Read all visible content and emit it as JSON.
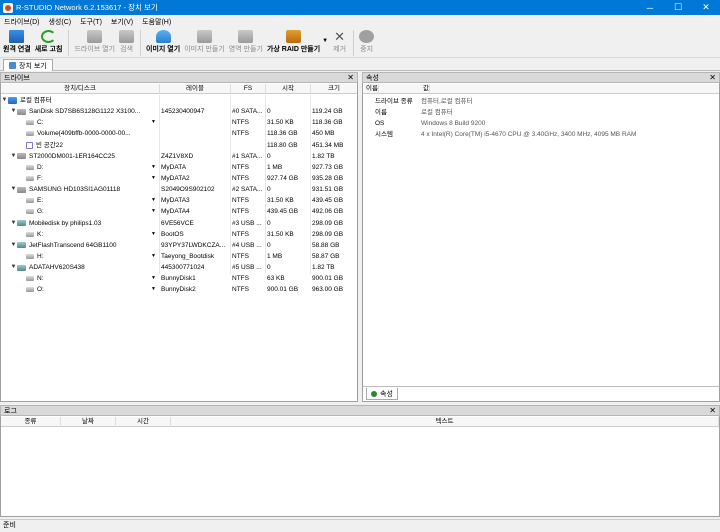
{
  "window": {
    "title": "R-STUDIO Network 6.2.153617 - 장치 보기",
    "minimize": "─",
    "maximize": "☐",
    "close": "✕"
  },
  "menu": [
    "드라이브(D)",
    "생성(C)",
    "도구(T)",
    "보기(V)",
    "도움말(H)"
  ],
  "toolbar": {
    "items": [
      {
        "label": "원격 연결",
        "icon": "remote-pc-icon",
        "enabled": true
      },
      {
        "label": "새로 고침",
        "icon": "refresh-icon",
        "enabled": true
      },
      {
        "label": "드라이브 열기",
        "icon": "open-drive-icon",
        "enabled": false
      },
      {
        "label": "검색",
        "icon": "search-icon",
        "enabled": false
      },
      {
        "label": "이미지 열기",
        "icon": "open-image-icon",
        "enabled": true
      },
      {
        "label": "이미지 만들기",
        "icon": "create-image-icon",
        "enabled": false
      },
      {
        "label": "영역 만들기",
        "icon": "create-region-icon",
        "enabled": false
      },
      {
        "label": "가상 RAID 만들기",
        "icon": "virtual-raid-icon",
        "enabled": true
      },
      {
        "label": "제거",
        "icon": "remove-icon",
        "enabled": false
      },
      {
        "label": "중지",
        "icon": "stop-icon",
        "enabled": false
      }
    ]
  },
  "tabs": {
    "device_view": "장치 보기"
  },
  "drives_panel": {
    "title": "드라이브",
    "columns": {
      "device": "장치/디스크",
      "label": "레이블",
      "fs": "FS",
      "start": "시작",
      "size": "크기"
    },
    "rows": [
      {
        "indent": 0,
        "caret": "▼",
        "icon": "pc",
        "name": "로컬 컴퓨터",
        "label": "",
        "fs": "",
        "start": "",
        "size": "",
        "dd": ""
      },
      {
        "indent": 1,
        "caret": "▼",
        "icon": "disk",
        "name": "SanDisk SD7SB6S128G1122 X3100...",
        "label": "145230400947",
        "fs": "#0 SATA...",
        "start": "0",
        "size": "119.24 GB",
        "dd": ""
      },
      {
        "indent": 2,
        "caret": "",
        "icon": "vol",
        "name": "C:",
        "label": "",
        "fs": "NTFS",
        "start": "31.50 KB",
        "size": "118.36 GB",
        "dd": "▼"
      },
      {
        "indent": 2,
        "caret": "",
        "icon": "vol",
        "name": "Volume{409bffb-0000-0000-00...",
        "label": "",
        "fs": "NTFS",
        "start": "118.36 GB",
        "size": "450 MB",
        "dd": ""
      },
      {
        "indent": 2,
        "caret": "",
        "icon": "free",
        "name": "빈 공간22",
        "label": "",
        "fs": "",
        "start": "118.80 GB",
        "size": "451.34 MB",
        "dd": ""
      },
      {
        "indent": 1,
        "caret": "▼",
        "icon": "disk",
        "name": "ST2000DM001-1ER164CC25",
        "label": "Z4Z1V8XD",
        "fs": "#1 SATA...",
        "start": "0",
        "size": "1.82 TB",
        "dd": ""
      },
      {
        "indent": 2,
        "caret": "",
        "icon": "vol",
        "name": "D:",
        "label": "MyDATA",
        "fs": "NTFS",
        "start": "1 MB",
        "size": "927.73 GB",
        "dd": "▼"
      },
      {
        "indent": 2,
        "caret": "",
        "icon": "vol",
        "name": "F:",
        "label": "MyDATA2",
        "fs": "NTFS",
        "start": "927.74 GB",
        "size": "935.28 GB",
        "dd": "▼"
      },
      {
        "indent": 1,
        "caret": "▼",
        "icon": "disk",
        "name": "SAMSUNG HD103SI1AG01118",
        "label": "S2049O9S902102",
        "fs": "#2 SATA...",
        "start": "0",
        "size": "931.51 GB",
        "dd": ""
      },
      {
        "indent": 2,
        "caret": "",
        "icon": "vol",
        "name": "E:",
        "label": "MyDATA3",
        "fs": "NTFS",
        "start": "31.50 KB",
        "size": "439.45 GB",
        "dd": "▼"
      },
      {
        "indent": 2,
        "caret": "",
        "icon": "vol",
        "name": "G:",
        "label": "MyDATA4",
        "fs": "NTFS",
        "start": "439.45 GB",
        "size": "492.06 GB",
        "dd": "▼"
      },
      {
        "indent": 1,
        "caret": "▼",
        "icon": "usb",
        "name": "Mobiledisk by philips1.03",
        "label": "6VE56VCE",
        "fs": "#3 USB ...",
        "start": "0",
        "size": "298.09 GB",
        "dd": ""
      },
      {
        "indent": 2,
        "caret": "",
        "icon": "vol",
        "name": "K:",
        "label": "BootOS",
        "fs": "NTFS",
        "start": "31.50 KB",
        "size": "298.09 GB",
        "dd": "▼"
      },
      {
        "indent": 1,
        "caret": "▼",
        "icon": "usb",
        "name": "JetFlashTranscend 64GB1100",
        "label": "93YPY37LWDKCZA...",
        "fs": "#4 USB ...",
        "start": "0",
        "size": "58.88 GB",
        "dd": ""
      },
      {
        "indent": 2,
        "caret": "",
        "icon": "vol",
        "name": "H:",
        "label": "Taeyong_Bootdisk",
        "fs": "NTFS",
        "start": "1 MB",
        "size": "58.87 GB",
        "dd": "▼"
      },
      {
        "indent": 1,
        "caret": "▼",
        "icon": "usb",
        "name": "ADATAHV620S438",
        "label": "445300771024",
        "fs": "#5 USB ...",
        "start": "0",
        "size": "1.82 TB",
        "dd": ""
      },
      {
        "indent": 2,
        "caret": "",
        "icon": "vol",
        "name": "N:",
        "label": "BunnyDisk1",
        "fs": "NTFS",
        "start": "63 KB",
        "size": "900.01 GB",
        "dd": "▼"
      },
      {
        "indent": 2,
        "caret": "",
        "icon": "vol",
        "name": "O:",
        "label": "BunnyDisk2",
        "fs": "NTFS",
        "start": "900.01 GB",
        "size": "963.00 GB",
        "dd": "▼"
      }
    ]
  },
  "props_panel": {
    "title": "속성",
    "columns": {
      "name": "이름",
      "value": "값"
    },
    "rows": [
      {
        "key": "드라이브 종류",
        "value": "컴퓨터,로컬 컴퓨터"
      },
      {
        "key": "이름",
        "value": "로컬 컴퓨터"
      },
      {
        "key": "OS",
        "value": "Windows 8 Build 9200"
      },
      {
        "key": "시스템",
        "value": "4 x Intel(R) Core(TM) i5-4670 CPU @ 3.40GHz, 3400 MHz, 4095 MB RAM"
      }
    ],
    "bottom_tab": "속성"
  },
  "log_panel": {
    "title": "로그",
    "columns": {
      "type": "종류",
      "date": "날짜",
      "time": "시간",
      "text": "텍스트"
    }
  },
  "status": "준비"
}
